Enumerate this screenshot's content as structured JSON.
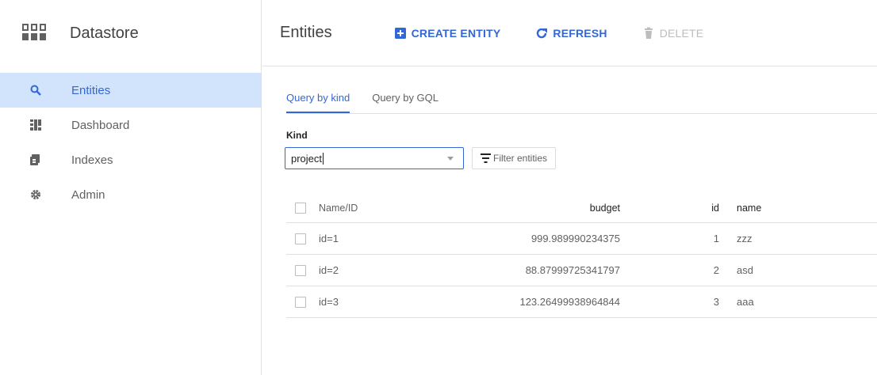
{
  "sidebar": {
    "title": "Datastore",
    "items": [
      {
        "label": "Entities",
        "icon": "search-icon"
      },
      {
        "label": "Dashboard",
        "icon": "dashboard-icon"
      },
      {
        "label": "Indexes",
        "icon": "indexes-icon"
      },
      {
        "label": "Admin",
        "icon": "gear-icon"
      }
    ]
  },
  "header": {
    "title": "Entities",
    "create_label": "CREATE ENTITY",
    "refresh_label": "REFRESH",
    "delete_label": "DELETE"
  },
  "tabs": [
    {
      "label": "Query by kind"
    },
    {
      "label": "Query by GQL"
    }
  ],
  "query": {
    "kind_label": "Kind",
    "kind_value": "project",
    "filter_label": "Filter entities"
  },
  "table": {
    "columns": [
      "Name/ID",
      "budget",
      "id",
      "name"
    ],
    "rows": [
      {
        "name_id": "id=1",
        "budget": "999.989990234375",
        "id": "1",
        "name": "zzz"
      },
      {
        "name_id": "id=2",
        "budget": "88.87999725341797",
        "id": "2",
        "name": "asd"
      },
      {
        "name_id": "id=3",
        "budget": "123.26499938964844",
        "id": "3",
        "name": "aaa"
      }
    ]
  },
  "colors": {
    "accent": "#3367d6",
    "active_bg": "#d2e3fc",
    "disabled": "#bdbdbd"
  }
}
